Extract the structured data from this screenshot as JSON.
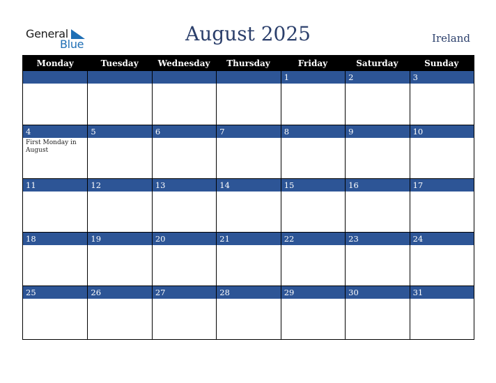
{
  "logo": {
    "line1": "General",
    "line2": "Blue",
    "icon": "triangle-flag-icon"
  },
  "header": {
    "title": "August 2025",
    "country": "Ireland"
  },
  "colors": {
    "accent": "#2d5596",
    "title": "#2b3f6b",
    "header_bg": "#000000",
    "logo_blue": "#1f6fb5"
  },
  "weekdays": [
    "Monday",
    "Tuesday",
    "Wednesday",
    "Thursday",
    "Friday",
    "Saturday",
    "Sunday"
  ],
  "weeks": [
    [
      {
        "day": "",
        "event": ""
      },
      {
        "day": "",
        "event": ""
      },
      {
        "day": "",
        "event": ""
      },
      {
        "day": "",
        "event": ""
      },
      {
        "day": "1",
        "event": ""
      },
      {
        "day": "2",
        "event": ""
      },
      {
        "day": "3",
        "event": ""
      }
    ],
    [
      {
        "day": "4",
        "event": "First Monday in August"
      },
      {
        "day": "5",
        "event": ""
      },
      {
        "day": "6",
        "event": ""
      },
      {
        "day": "7",
        "event": ""
      },
      {
        "day": "8",
        "event": ""
      },
      {
        "day": "9",
        "event": ""
      },
      {
        "day": "10",
        "event": ""
      }
    ],
    [
      {
        "day": "11",
        "event": ""
      },
      {
        "day": "12",
        "event": ""
      },
      {
        "day": "13",
        "event": ""
      },
      {
        "day": "14",
        "event": ""
      },
      {
        "day": "15",
        "event": ""
      },
      {
        "day": "16",
        "event": ""
      },
      {
        "day": "17",
        "event": ""
      }
    ],
    [
      {
        "day": "18",
        "event": ""
      },
      {
        "day": "19",
        "event": ""
      },
      {
        "day": "20",
        "event": ""
      },
      {
        "day": "21",
        "event": ""
      },
      {
        "day": "22",
        "event": ""
      },
      {
        "day": "23",
        "event": ""
      },
      {
        "day": "24",
        "event": ""
      }
    ],
    [
      {
        "day": "25",
        "event": ""
      },
      {
        "day": "26",
        "event": ""
      },
      {
        "day": "27",
        "event": ""
      },
      {
        "day": "28",
        "event": ""
      },
      {
        "day": "29",
        "event": ""
      },
      {
        "day": "30",
        "event": ""
      },
      {
        "day": "31",
        "event": ""
      }
    ]
  ]
}
